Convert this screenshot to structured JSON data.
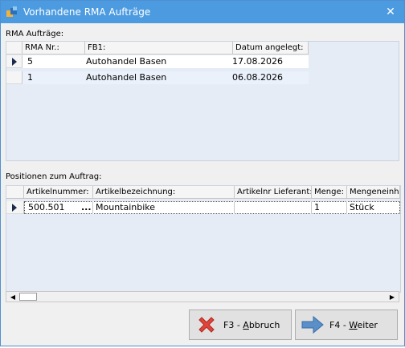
{
  "window": {
    "title": "Vorhandene RMA Aufträge",
    "close_glyph": "✕"
  },
  "rma": {
    "section_label": "RMA Aufträge:",
    "columns": [
      "RMA Nr.:",
      "FB1:",
      "Datum angelegt:"
    ],
    "rows": [
      {
        "nr": "5",
        "fb1": "Autohandel Basen",
        "datum": "17.08.2026",
        "selected": true
      },
      {
        "nr": "1",
        "fb1": "Autohandel Basen",
        "datum": "06.08.2026",
        "selected": false
      }
    ]
  },
  "positionen": {
    "section_label": "Positionen zum Auftrag:",
    "columns": [
      "Artikelnummer:",
      "Artikelbezeichnung:",
      "Artikelnr Lieferant:",
      "Menge:",
      "Mengeneinh"
    ],
    "rows": [
      {
        "artikelnummer": "500.501",
        "ellipsis": "...",
        "bezeichnung": "Mountainbike",
        "lieferant": "",
        "menge": "1",
        "einheit": "Stück"
      }
    ]
  },
  "scrollbar": {
    "left_arrow": "◀",
    "right_arrow": "▶"
  },
  "buttons": {
    "abbruch": {
      "prefix": "F3 - ",
      "accel": "A",
      "rest": "bbruch",
      "icon": "red-x-icon"
    },
    "weiter": {
      "prefix": "F4 - ",
      "accel": "W",
      "rest": "eiter",
      "icon": "blue-arrow-right-icon"
    }
  }
}
